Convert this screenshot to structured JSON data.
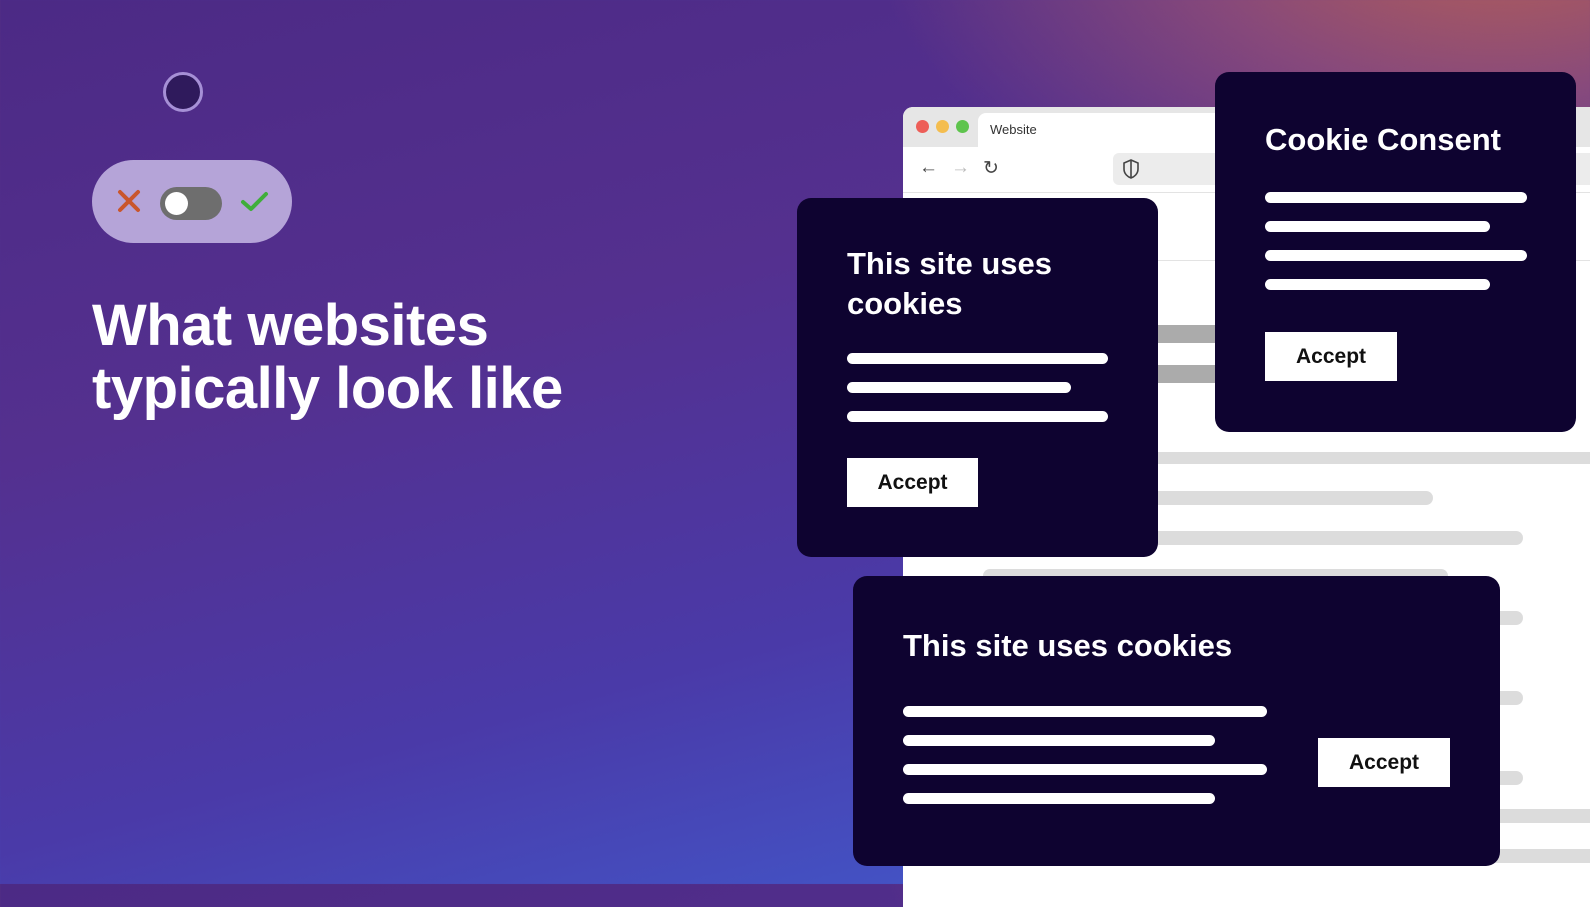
{
  "headline": "What websites typically look like",
  "toggle": {
    "state": "off",
    "reject_icon": "x-icon",
    "accept_icon": "check-icon",
    "colors": {
      "reject": "#c9562c",
      "accept": "#3fae3a",
      "track": "#6e6e6e",
      "pill": "#b5a4d8"
    }
  },
  "browser": {
    "tab_title": "Website",
    "traffic_lights": [
      "#ed5e58",
      "#f4bd4f",
      "#5ec44d"
    ],
    "nav_icons": [
      "arrow-left-icon",
      "arrow-right-icon",
      "reload-icon",
      "shield-icon"
    ],
    "nav_glyphs": {
      "back": "←",
      "forward": "→",
      "reload": "↻"
    }
  },
  "cards": [
    {
      "title": "This site uses cookies",
      "text_lines": 3,
      "button": "Accept"
    },
    {
      "title": "Cookie Consent",
      "text_lines": 4,
      "button": "Accept"
    },
    {
      "title": "This site uses cookies",
      "text_lines": 4,
      "button": "Accept"
    }
  ],
  "colors": {
    "card_bg": "#0e0330",
    "button_bg": "#ffffff"
  }
}
